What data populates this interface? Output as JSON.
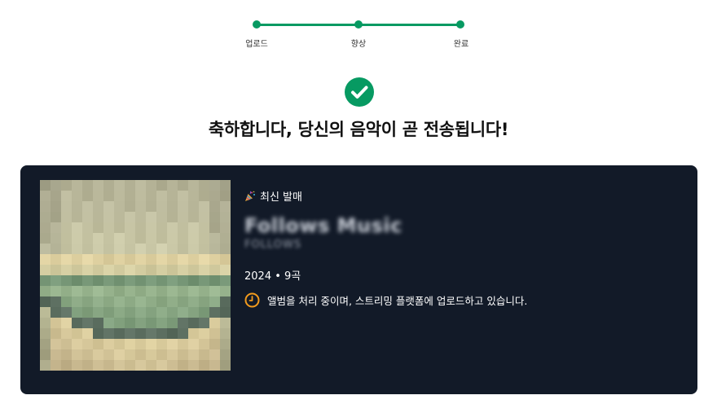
{
  "stepper": {
    "steps": [
      {
        "label": "업로드"
      },
      {
        "label": "향상"
      },
      {
        "label": "완료"
      }
    ],
    "active_color": "#079a62"
  },
  "success": {
    "icon": "check-circle-icon",
    "headline": "축하합니다, 당신의 음악이 곧 전송됩니다!"
  },
  "album": {
    "release_tag_icon": "party-popper-icon",
    "release_tag": "최신 발매",
    "title": "Follows Music",
    "artist": "FOLLOWS",
    "meta": "2024 • 9곡",
    "status_icon": "clock-icon",
    "status_text": "앨범을 처리 중이며, 스트리밍 플랫폼에 업로드하고 있습니다."
  },
  "colors": {
    "accent": "#079a62",
    "card_background": "#121a28",
    "status_icon": "#f29b1d"
  }
}
